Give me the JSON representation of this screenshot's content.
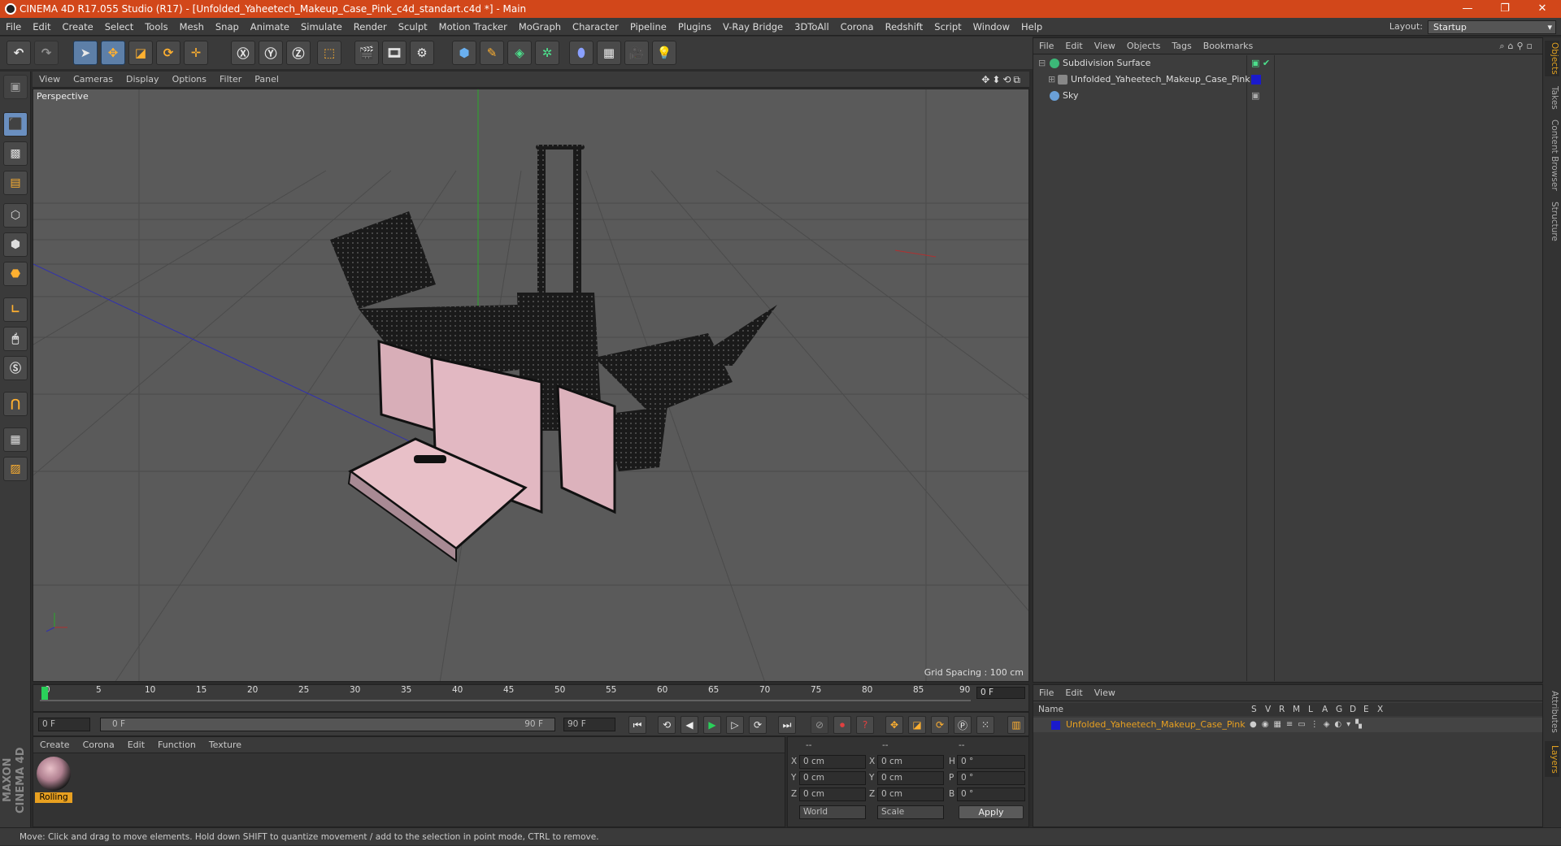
{
  "window": {
    "title": "CINEMA 4D R17.055 Studio (R17) - [Unfolded_Yaheetech_Makeup_Case_Pink_c4d_standart.c4d *] - Main",
    "minimize": "—",
    "restore": "❐",
    "close": "✕"
  },
  "menubar": {
    "items": [
      "File",
      "Edit",
      "Create",
      "Select",
      "Tools",
      "Mesh",
      "Snap",
      "Animate",
      "Simulate",
      "Render",
      "Sculpt",
      "Motion Tracker",
      "MoGraph",
      "Character",
      "Pipeline",
      "Plugins",
      "V-Ray Bridge",
      "3DToAll",
      "Corona",
      "Redshift",
      "Script",
      "Window",
      "Help"
    ],
    "layout_label": "Layout:",
    "layout_value": "Startup"
  },
  "viewport": {
    "menu": [
      "View",
      "Cameras",
      "Display",
      "Options",
      "Filter",
      "Panel"
    ],
    "label": "Perspective",
    "grid_spacing": "Grid Spacing : 100 cm",
    "nav_icons": "✥⬍⟲⧉"
  },
  "timeline": {
    "ticks": [
      "0",
      "5",
      "10",
      "15",
      "20",
      "25",
      "30",
      "35",
      "40",
      "45",
      "50",
      "55",
      "60",
      "65",
      "70",
      "75",
      "80",
      "85",
      "90"
    ],
    "current_frame": "0 F",
    "start_field": "0 F",
    "range_start": "0 F",
    "range_end": "90 F",
    "end_field": "90 F"
  },
  "material_panel": {
    "menu": [
      "Create",
      "Corona",
      "Edit",
      "Function",
      "Texture"
    ],
    "material_name": "Rolling"
  },
  "coordinates": {
    "header": [
      "--",
      "--",
      "--"
    ],
    "rows": [
      {
        "a": "X",
        "av": "0 cm",
        "b": "X",
        "bv": "0 cm",
        "c": "H",
        "cv": "0 °"
      },
      {
        "a": "Y",
        "av": "0 cm",
        "b": "Y",
        "bv": "0 cm",
        "c": "P",
        "cv": "0 °"
      },
      {
        "a": "Z",
        "av": "0 cm",
        "b": "Z",
        "bv": "0 cm",
        "c": "B",
        "cv": "0 °"
      }
    ],
    "space": "World",
    "mode": "Scale",
    "apply": "Apply"
  },
  "object_manager": {
    "menu": [
      "File",
      "Edit",
      "View",
      "Objects",
      "Tags",
      "Bookmarks"
    ],
    "objects": [
      {
        "name": "Subdivision Surface",
        "color": "#3cb878"
      },
      {
        "name": "Unfolded_Yaheetech_Makeup_Case_Pink",
        "color": "#1a1acc"
      },
      {
        "name": "Sky",
        "color": "#6aa0d8"
      }
    ]
  },
  "layer_manager": {
    "menu": [
      "File",
      "Edit",
      "View"
    ],
    "columns": [
      "Name",
      "S",
      "V",
      "R",
      "M",
      "L",
      "A",
      "G",
      "D",
      "E",
      "X"
    ],
    "layer_name": "Unfolded_Yaheetech_Makeup_Case_Pink",
    "layer_color": "#1a1acc"
  },
  "right_tabs": [
    "Objects",
    "Takes",
    "Content Browser",
    "Structure"
  ],
  "right_tabs_lower": [
    "Attributes",
    "Layers"
  ],
  "status": "Move: Click and drag to move elements. Hold down SHIFT to quantize movement / add to the selection in point mode, CTRL to remove.",
  "maxon_logo": "MAXON CINEMA 4D"
}
